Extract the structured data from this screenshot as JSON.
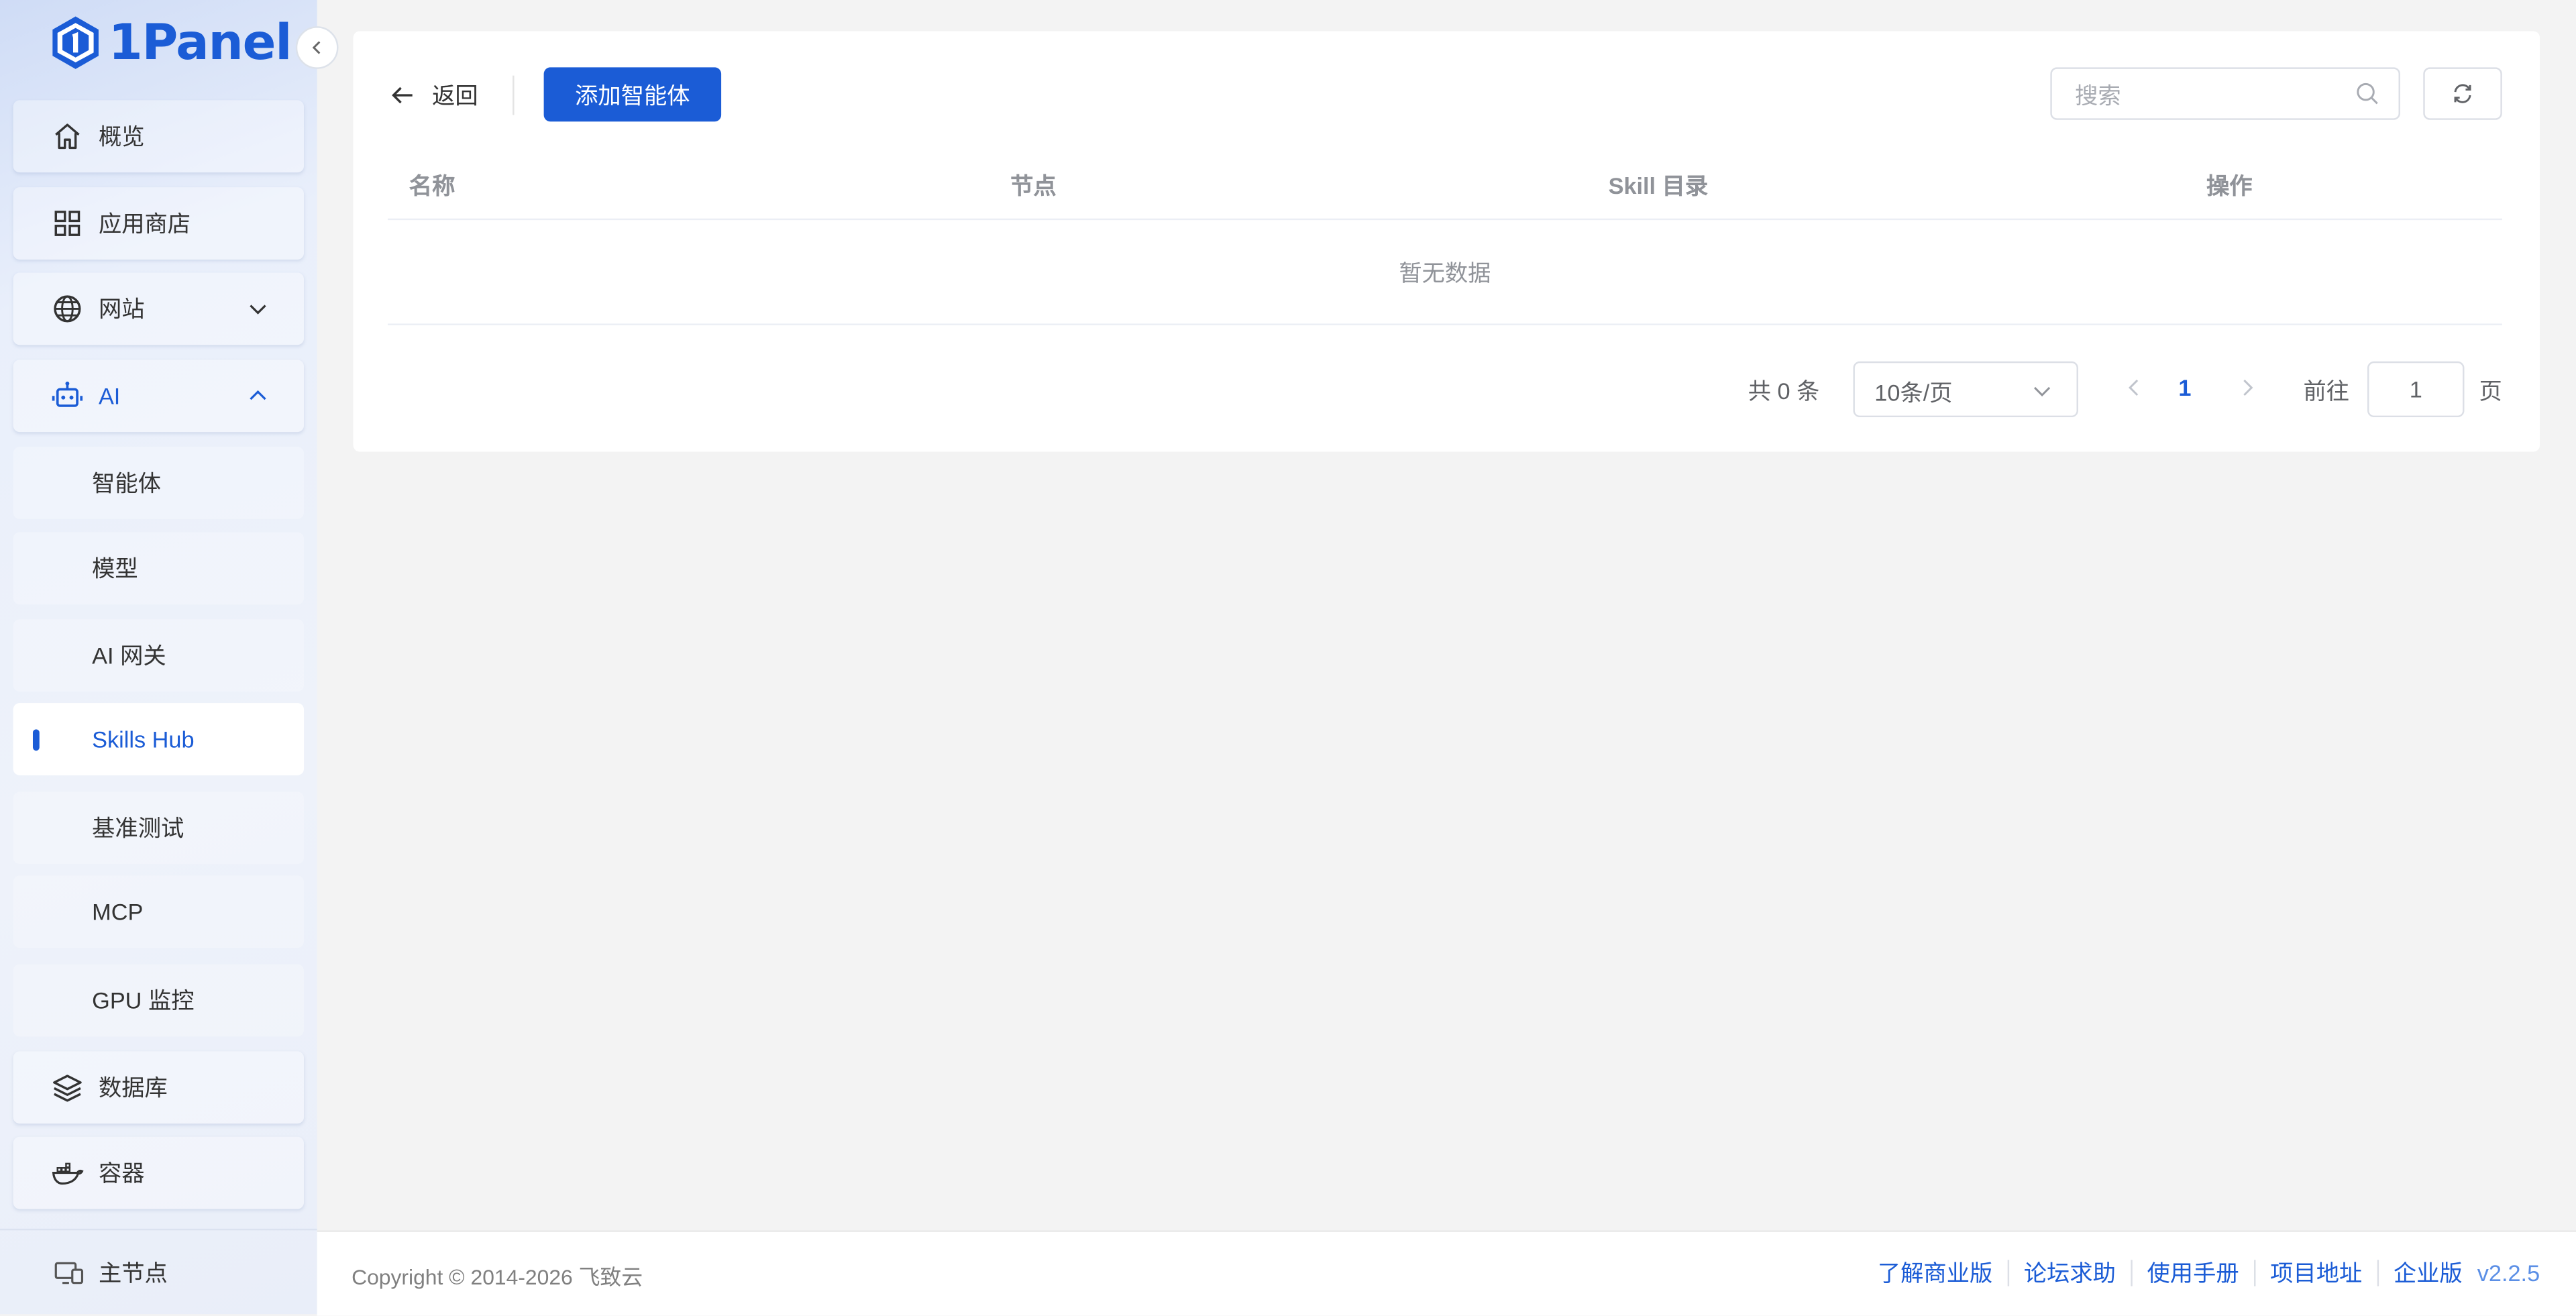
{
  "app": {
    "logo_text": "1Panel"
  },
  "sidebar": {
    "items": [
      {
        "label": "概览",
        "icon": "home-icon"
      },
      {
        "label": "应用商店",
        "icon": "grid-icon"
      },
      {
        "label": "网站",
        "icon": "globe-icon"
      },
      {
        "label": "AI",
        "icon": "robot-icon"
      }
    ],
    "ai_sub": [
      "智能体",
      "模型",
      "AI 网关",
      "Skills Hub",
      "基准测试",
      "MCP",
      "GPU 监控"
    ],
    "items_after": [
      {
        "label": "数据库",
        "icon": "layers-icon"
      },
      {
        "label": "容器",
        "icon": "docker-icon"
      }
    ],
    "node": "主节点",
    "active_sub": "Skills Hub"
  },
  "toolbar": {
    "back_label": "返回",
    "add_label": "添加智能体",
    "search_placeholder": "搜索"
  },
  "table": {
    "columns": [
      "名称",
      "节点",
      "Skill 目录",
      "操作"
    ],
    "empty_text": "暂无数据"
  },
  "pagination": {
    "total_text": "共 0 条",
    "page_size": "10条/页",
    "current_page": "1",
    "goto_label": "前往",
    "goto_value": "1",
    "page_suffix": "页"
  },
  "footer": {
    "copyright": "Copyright © 2014-2026 飞致云",
    "links": [
      "了解商业版",
      "论坛求助",
      "使用手册",
      "项目地址",
      "企业版"
    ],
    "version": "v2.2.5"
  },
  "colors": {
    "accent": "#1b5cd6",
    "background": "#f3f3f3"
  }
}
